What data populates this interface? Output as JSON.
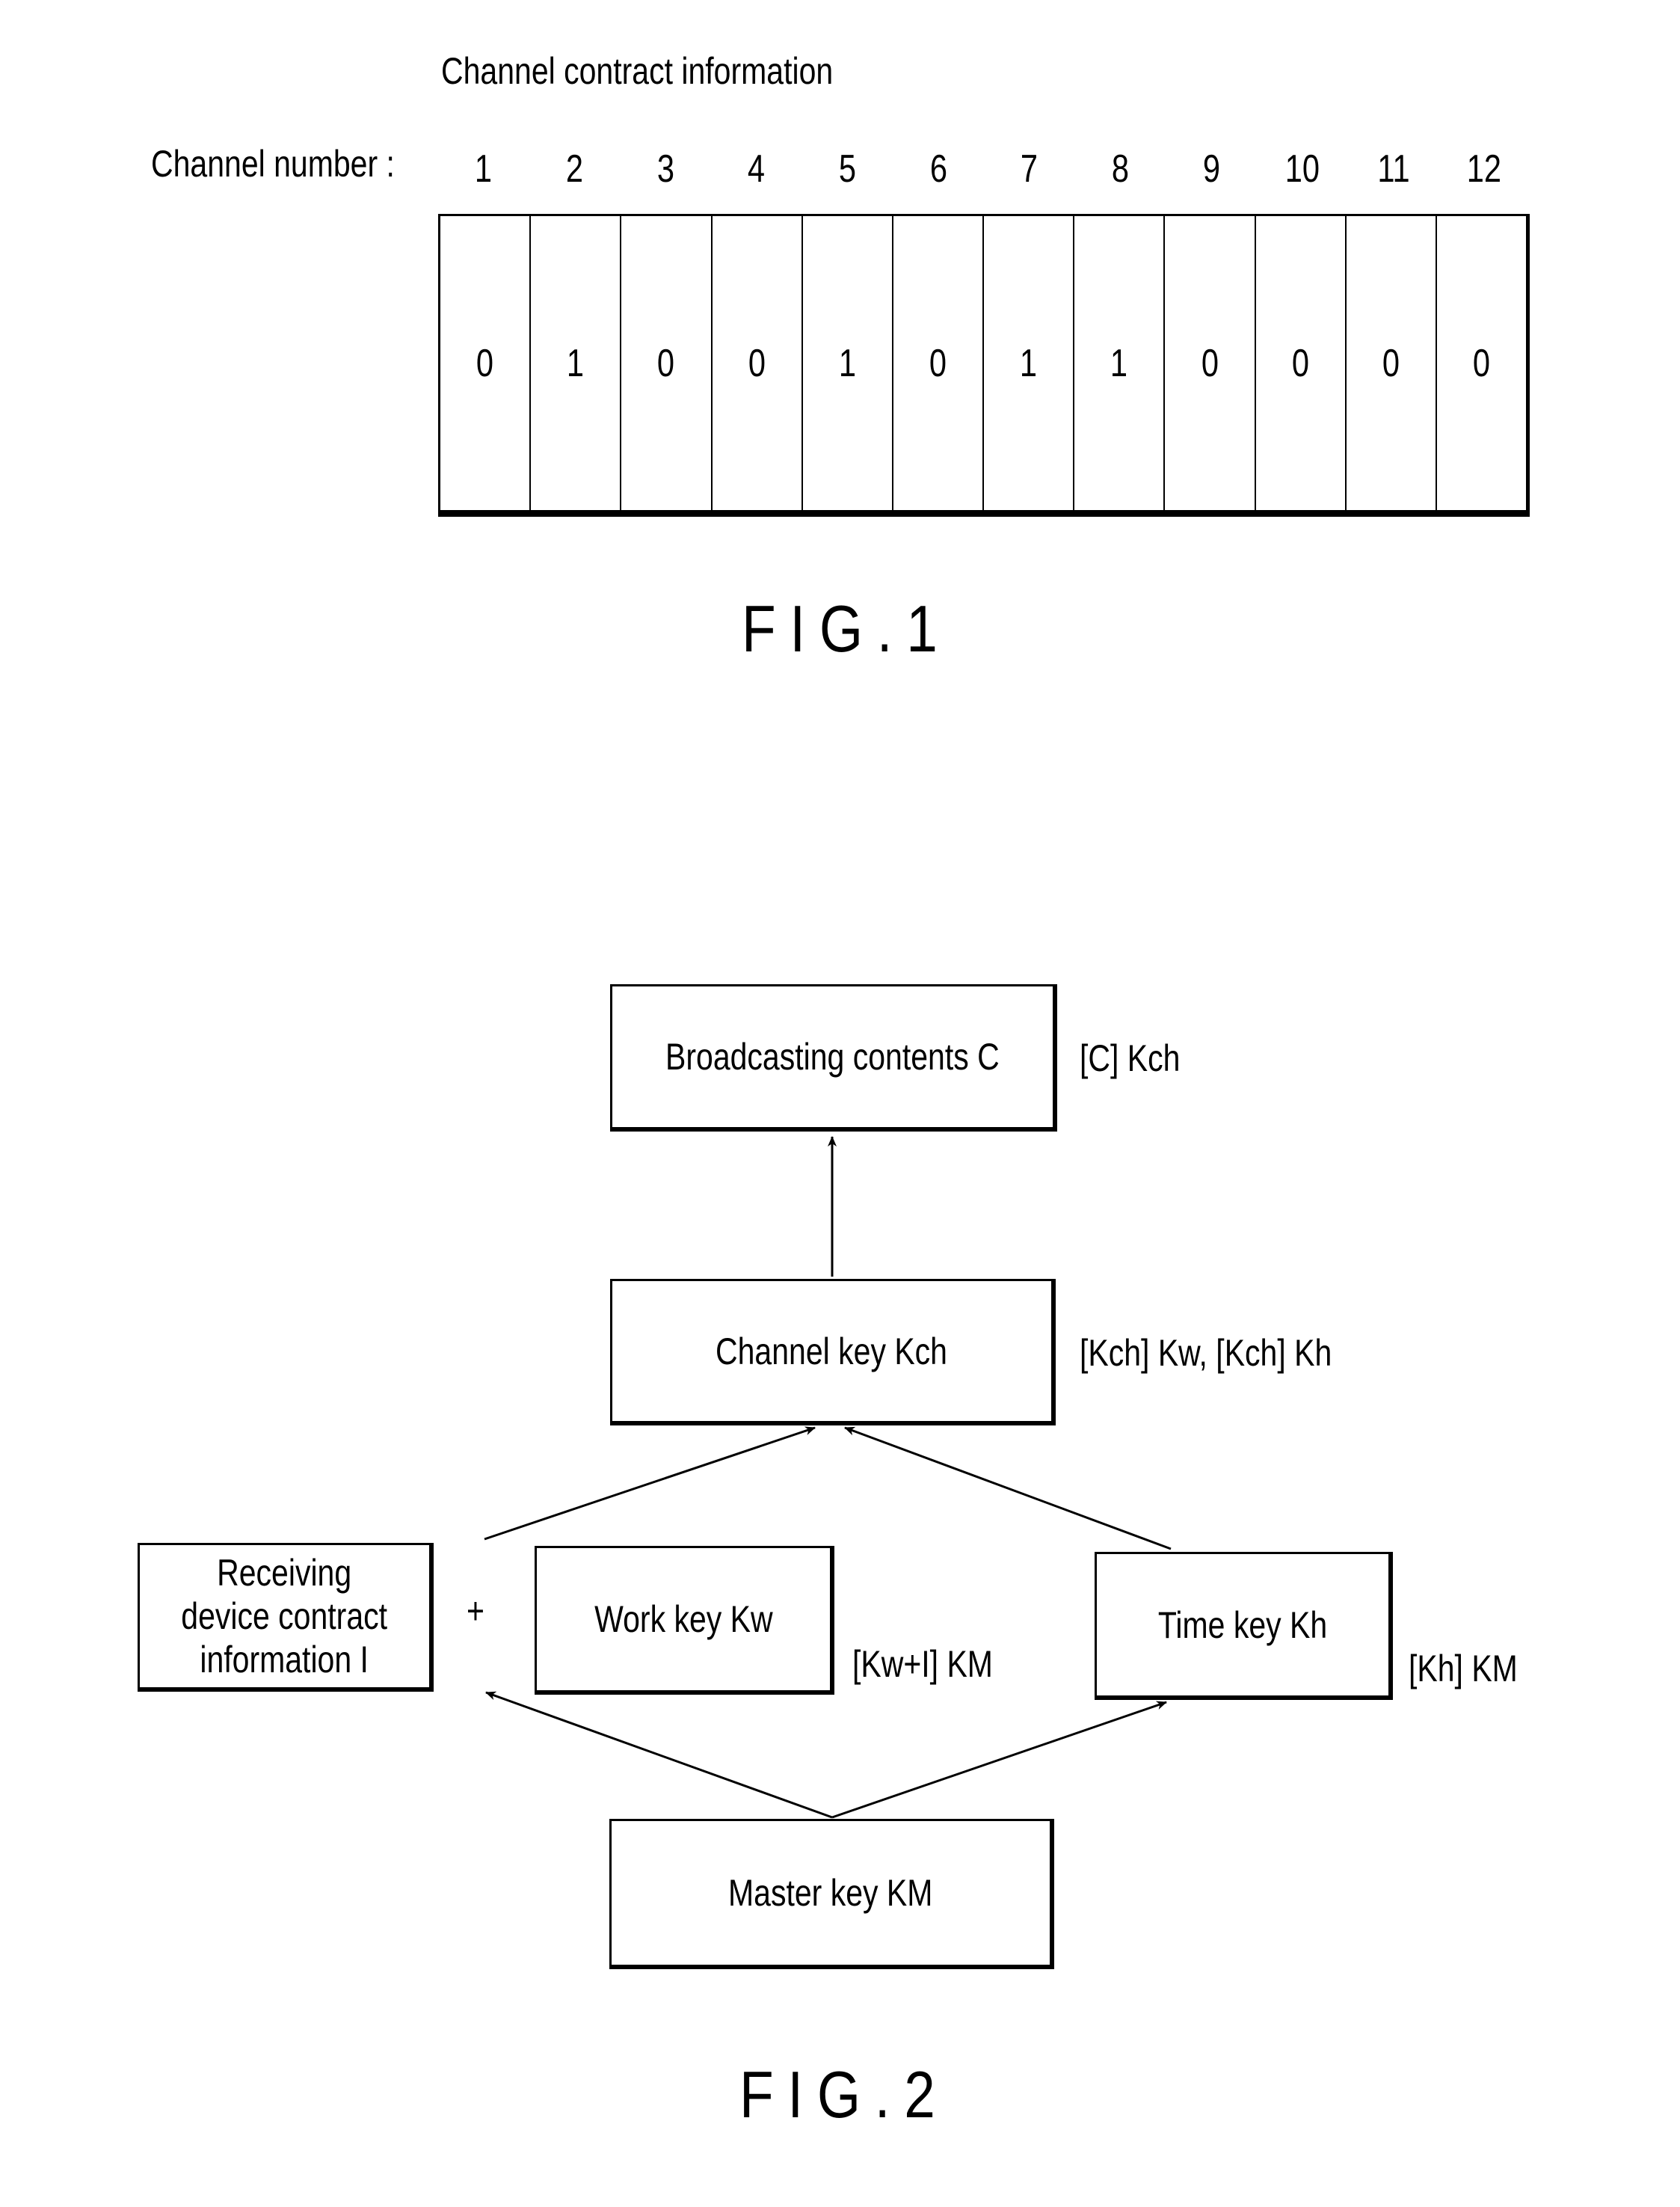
{
  "fig1": {
    "title": "Channel contract information",
    "row_label": "Channel number :",
    "channels": [
      {
        "number": "1",
        "value": "0"
      },
      {
        "number": "2",
        "value": "1"
      },
      {
        "number": "3",
        "value": "0"
      },
      {
        "number": "4",
        "value": "0"
      },
      {
        "number": "5",
        "value": "1"
      },
      {
        "number": "6",
        "value": "0"
      },
      {
        "number": "7",
        "value": "1"
      },
      {
        "number": "8",
        "value": "1"
      },
      {
        "number": "9",
        "value": "0"
      },
      {
        "number": "10",
        "value": "0"
      },
      {
        "number": "11",
        "value": "0"
      },
      {
        "number": "12",
        "value": "0"
      }
    ],
    "caption": "FIG.1"
  },
  "fig2": {
    "nodes": {
      "broadcasting": {
        "label": "Broadcasting contents C",
        "annotation": "[C] Kch"
      },
      "channel_key": {
        "label": "Channel key Kch",
        "annotation": "[Kch] Kw, [Kch] Kh"
      },
      "receiving": {
        "label": "Receiving\ndevice contract\ninformation I"
      },
      "plus": "+",
      "work_key": {
        "label": "Work key Kw",
        "annotation": "[Kw+I] KM"
      },
      "time_key": {
        "label": "Time key Kh",
        "annotation": "[Kh] KM"
      },
      "master_key": {
        "label": "Master key KM"
      }
    },
    "edges": [
      {
        "from": "channel_key",
        "to": "broadcasting"
      },
      {
        "from": "receiving+work_key",
        "to": "channel_key"
      },
      {
        "from": "time_key",
        "to": "channel_key"
      },
      {
        "from": "master_key",
        "to": "receiving+work_key"
      },
      {
        "from": "master_key",
        "to": "time_key"
      }
    ],
    "caption": "FIG.2"
  }
}
